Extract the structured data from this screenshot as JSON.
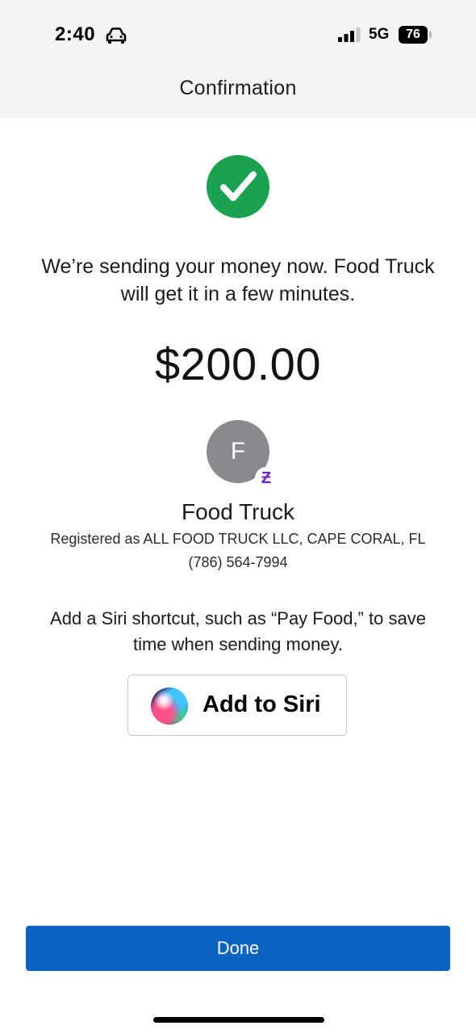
{
  "status_bar": {
    "time": "2:40",
    "time_icon": "car-icon",
    "signal_icon": "cellular-signal-icon",
    "network": "5G",
    "battery": "76"
  },
  "header": {
    "title": "Confirmation"
  },
  "confirmation": {
    "status_icon": "check-circle-icon",
    "status_color": "#1aa251",
    "message": "We’re sending your money now. Food Truck will get it in a few minutes.",
    "amount": "$200.00"
  },
  "recipient": {
    "initial": "F",
    "badge_icon": "zelle-icon",
    "badge_symbol": "Ƶ",
    "name": "Food Truck",
    "registered": "Registered as ALL FOOD TRUCK LLC, CAPE CORAL, FL",
    "phone": "(786) 564-7994"
  },
  "siri": {
    "description": "Add a Siri shortcut, such as “Pay Food,” to save time when sending money.",
    "button_label": "Add to Siri",
    "button_icon": "siri-icon"
  },
  "footer": {
    "done_label": "Done",
    "done_color": "#0b63c4"
  }
}
